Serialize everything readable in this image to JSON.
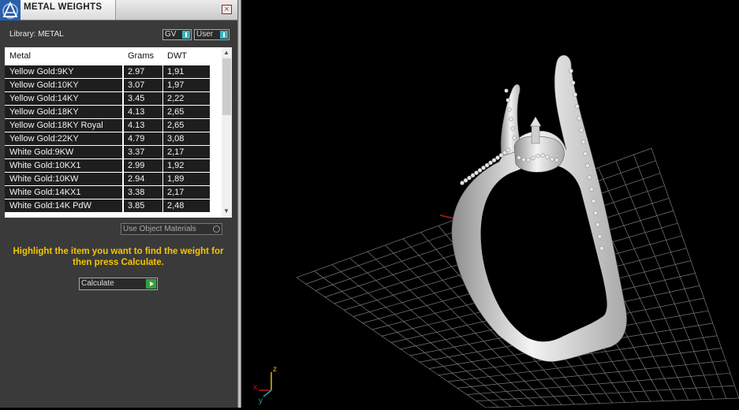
{
  "panel": {
    "title": "METAL WEIGHTS",
    "close_label": "×",
    "library_label": "Library: METAL",
    "toggles": {
      "gv_label": "GV",
      "user_label": "User"
    },
    "table": {
      "headers": {
        "metal": "Metal",
        "grams": "Grams",
        "dwt": "DWT"
      },
      "rows": [
        {
          "metal": "Yellow Gold:9KY",
          "grams": "2.97",
          "dwt": "1,91"
        },
        {
          "metal": "Yellow Gold:10KY",
          "grams": "3.07",
          "dwt": "1,97"
        },
        {
          "metal": "Yellow Gold:14KY",
          "grams": "3.45",
          "dwt": "2,22"
        },
        {
          "metal": "Yellow Gold:18KY",
          "grams": "4.13",
          "dwt": "2,65"
        },
        {
          "metal": "Yellow Gold:18KY Royal",
          "grams": "4.13",
          "dwt": "2,65"
        },
        {
          "metal": "Yellow Gold:22KY",
          "grams": "4.79",
          "dwt": "3,08"
        },
        {
          "metal": "White Gold:9KW",
          "grams": "3.37",
          "dwt": "2,17"
        },
        {
          "metal": "White Gold:10KX1",
          "grams": "2.99",
          "dwt": "1,92"
        },
        {
          "metal": "White Gold:10KW",
          "grams": "2.94",
          "dwt": "1,89"
        },
        {
          "metal": "White Gold:14KX1",
          "grams": "3.38",
          "dwt": "2,17"
        },
        {
          "metal": "White Gold:14K PdW",
          "grams": "3.85",
          "dwt": "2,48"
        }
      ]
    },
    "use_object_label": "Use Object Materials",
    "instruction": "Highlight the item you want to find the weight for then press Calculate.",
    "calculate_label": "Calculate"
  },
  "viewport": {
    "axes": {
      "z": "z",
      "x": "x",
      "y": "y"
    },
    "colors": {
      "x_axis": "#c0141e",
      "y_axis": "#12a6b8",
      "grid": "#7a7a7a",
      "label": "#e6b800"
    }
  }
}
